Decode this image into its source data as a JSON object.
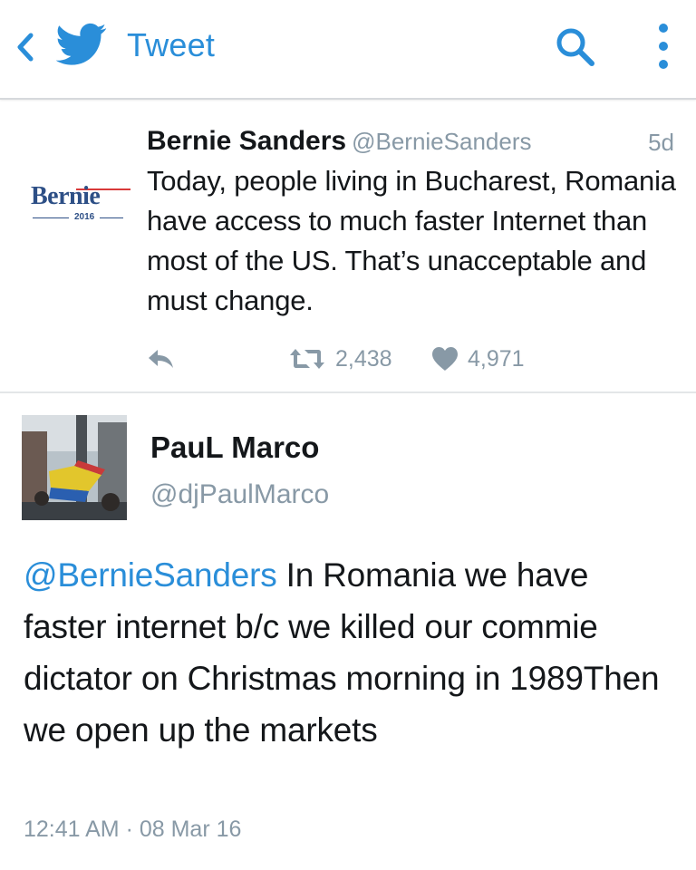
{
  "header": {
    "title": "Tweet",
    "icons": {
      "back": "chevron-left-icon",
      "logo": "twitter-bird-icon",
      "search": "search-icon",
      "more": "more-vertical-icon"
    },
    "accent_color": "#2a8ed9"
  },
  "parent_tweet": {
    "author_name": "Bernie Sanders",
    "author_handle": "@BernieSanders",
    "time_ago": "5d",
    "avatar": {
      "logo_text": "Bernie",
      "logo_year": "2016"
    },
    "text": "Today, people living in Bucharest, Romania have access to much faster Internet than most of the US. That’s unacceptable and must change.",
    "retweet_count": "2,438",
    "like_count": "4,971"
  },
  "reply_tweet": {
    "author_name": "PauL Marco",
    "author_handle": "@djPaulMarco",
    "mention": "@BernieSanders",
    "text": " In Romania we have faster internet b/c we killed our commie dictator on Christmas morning in 1989Then we open up the markets",
    "timestamp": "12:41 AM · 08 Mar 16"
  },
  "colors": {
    "text_primary": "#14171a",
    "text_secondary": "#8899a6",
    "link": "#2a8ed9",
    "divider": "#e3e6e8"
  }
}
